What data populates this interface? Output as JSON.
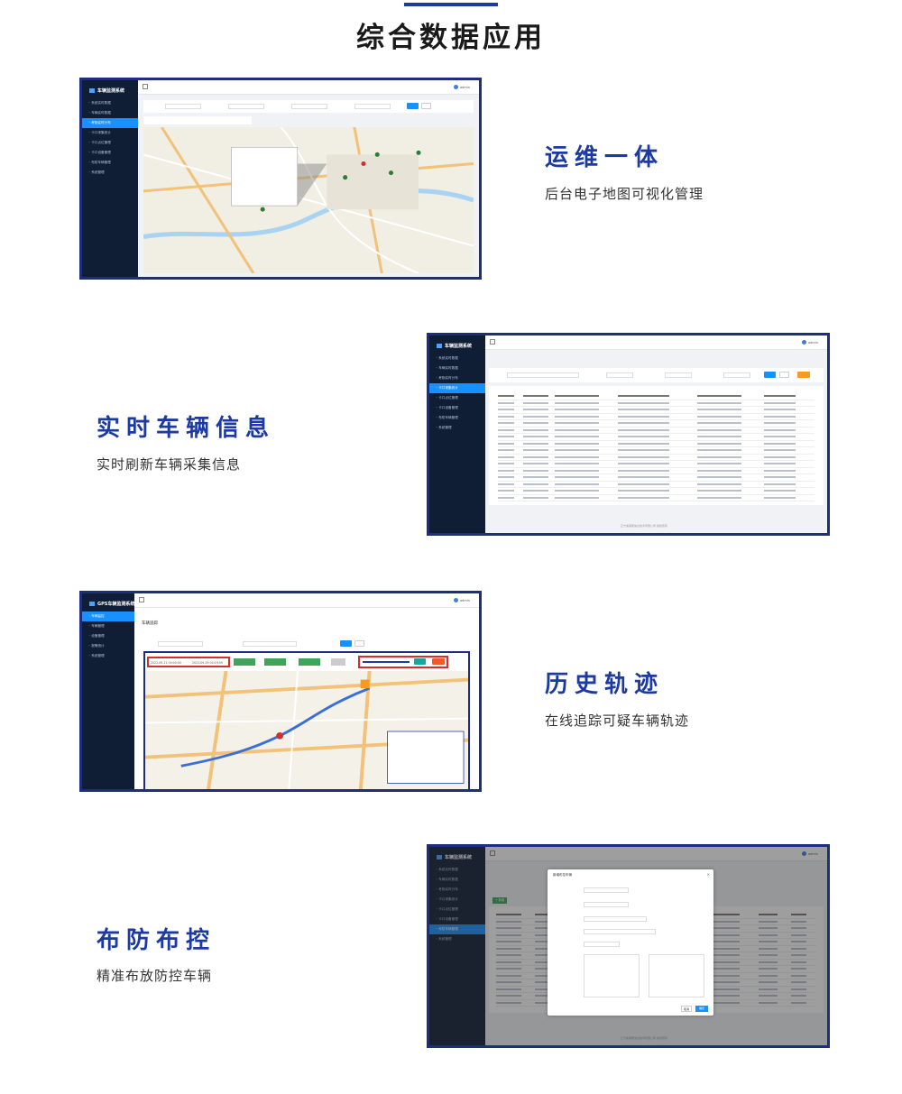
{
  "page": {
    "title": "综合数据应用",
    "accent_color": "#1c3a9f"
  },
  "features": [
    {
      "title": "运维一体",
      "desc": "后台电子地图可视化管理"
    },
    {
      "title": "实时车辆信息",
      "desc": "实时刷新车辆采集信息"
    },
    {
      "title": "历史轨迹",
      "desc": "在线追踪可疑车辆轨迹"
    },
    {
      "title": "布防布控",
      "desc": "精准布放防控车辆"
    }
  ],
  "screens": {
    "one": {
      "app_name": "车辆监测系统",
      "user": "admin",
      "sidebar": [
        "系统实时数据",
        "车辆实时数据",
        "考勤实时分布",
        "卡口采集统计",
        "卡口点位管理",
        "卡口设备管理",
        "布防车辆管理",
        "系统管理"
      ],
      "active_index": 2
    },
    "two": {
      "app_name": "车辆监测系统",
      "user": "admin",
      "sidebar": [
        "系统实时数据",
        "车辆实时数据",
        "考勤实时分布",
        "卡口采集统计",
        "卡口点位管理",
        "卡口设备管理",
        "布防车辆管理",
        "系统管理"
      ],
      "active_index": 3,
      "footer": "辽宁奥莱斯信息技术有限公司 版权所有"
    },
    "three": {
      "app_name": "GPS车辆监测系统",
      "user": "admin",
      "sidebar": [
        "车辆监控",
        "车辆管理",
        "设备管理",
        "报警统计",
        "系统管理"
      ],
      "active_index": 0,
      "page_title": "车辆追踪",
      "start_time": "2022-09-21 00:00:00",
      "end_time": "2022-09-29 04:19:59",
      "start_button": "开始",
      "stop_button": "停止"
    },
    "four": {
      "app_name": "车辆监测系统",
      "user": "admin",
      "sidebar": [
        "系统实时数据",
        "车辆实时数据",
        "考勤实时分布",
        "卡口采集统计",
        "卡口点位管理",
        "卡口设备管理",
        "布防车辆管理",
        "系统管理"
      ],
      "active_index": 6,
      "modal_title": "新增布控车辆",
      "add_button": "+ 新增",
      "cancel_button": "取消",
      "confirm_button": "确定",
      "footer": "辽宁奥莱斯信息技术有限公司 版权所有"
    }
  }
}
